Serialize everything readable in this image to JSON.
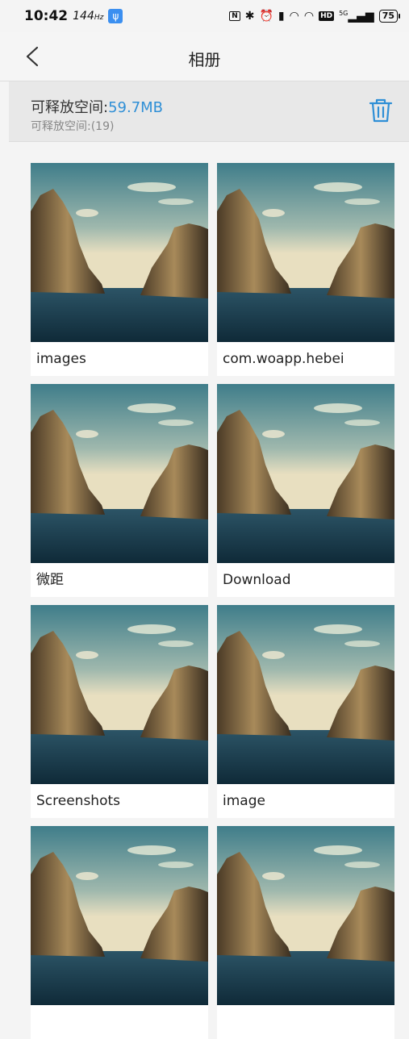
{
  "status_bar": {
    "time": "10:42",
    "refresh_rate": "144",
    "refresh_unit": "Hz",
    "signal_label": "5G",
    "battery": "75"
  },
  "header": {
    "title": "相册"
  },
  "storage": {
    "label": "可释放空间:",
    "value": "59.7MB",
    "count_text": "可释放空间:(19)"
  },
  "albums": [
    {
      "name": "images"
    },
    {
      "name": "com.woapp.hebei"
    },
    {
      "name": "微距"
    },
    {
      "name": "Download"
    },
    {
      "name": "Screenshots"
    },
    {
      "name": "image"
    },
    {
      "name": ""
    },
    {
      "name": ""
    }
  ],
  "colors": {
    "accent": "#2f8fd6",
    "background": "#f4f4f4",
    "panel": "#e8e8e8"
  }
}
